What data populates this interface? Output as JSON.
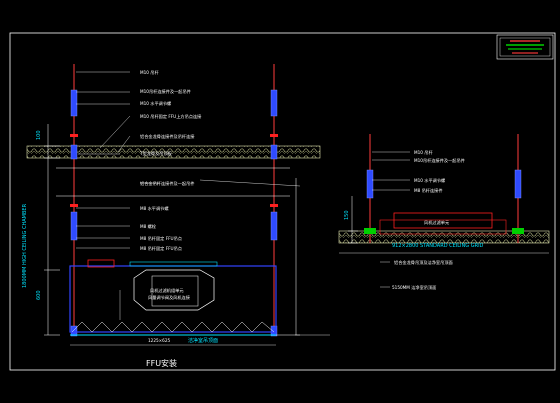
{
  "drawing": {
    "title": "FFU安装",
    "left_section": {
      "labels": {
        "rod": "M10 吊杆",
        "rod_connector": "M10吊杆连接件及一起吊件",
        "nut_washer": "M10 水平调节螺",
        "ffu_hanger": "M10 吊杆固定 FFU上方吊点连接",
        "ceiling_support": "铝合金龙骨连接件及吊杆连接",
        "ceiling_grid": "T型龙骨及吊顶板",
        "connector_2": "铝合金吊杆连接件及一起吊件",
        "nut_2": "M8 水平调节螺",
        "bolt": "M8 螺栓",
        "hanger_2": "M8 吊杆固定 FFU吊点",
        "fan_label_1": "风机过滤机组单元",
        "fan_label_2": "风量调节阀及风机连接"
      },
      "dimensions": {
        "top_gap": "100",
        "chamber_height": "600",
        "vertical_note": "1800MM HIGH CEILING CHAMBER",
        "ffu_size": "1225×625",
        "bottom_label": "洁净室吊顶面"
      }
    },
    "right_section": {
      "labels": {
        "rod": "M10 吊杆",
        "rod_connector": "M10吊杆连接件及一起吊件",
        "nut_washer": "M10 水平调节螺",
        "hanger_2": "M8 吊杆连接件",
        "unit": "风机过滤单元",
        "grid_note": "912×2800 STANDARD CEILING GRID",
        "below_1": "铝合金龙骨吊顶及洁净室吊顶面",
        "below_2": "5150MM 洁净室吊顶面"
      },
      "dimensions": {
        "side_dim": "150"
      }
    },
    "colors": {
      "background": "#000000",
      "frame": "#ffffff",
      "rod": "#ff3b3b",
      "fitting": "#2f4bff",
      "ceiling": "#e0e4b0",
      "unit_box": "#ff2020",
      "filter": "#3344ff",
      "label_text": "#ffffff",
      "dim_text": "#00e5ff",
      "clip": "#00d000"
    }
  }
}
